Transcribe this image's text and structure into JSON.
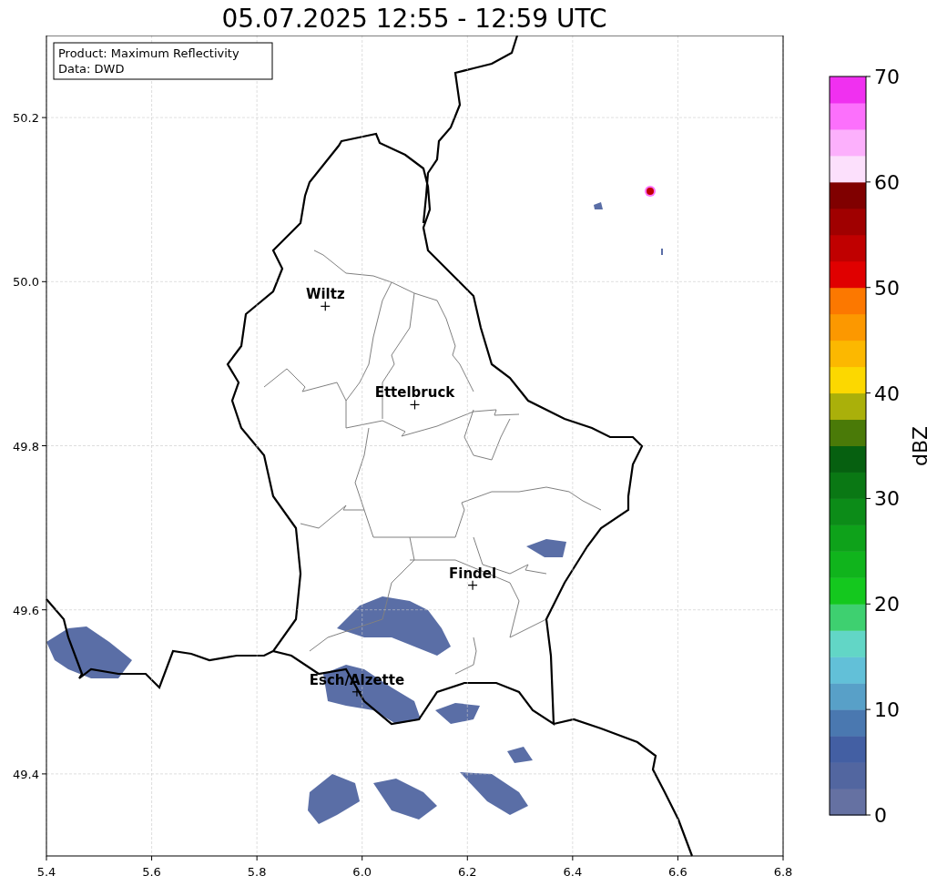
{
  "figure": {
    "info_box": {
      "lines": [
        "Product: Maximum Reflectivity",
        "Data: DWD"
      ]
    },
    "chart_data": {
      "type": "scatter",
      "title": "05.07.2025 12:55 - 12:59 UTC",
      "x": [
        5.93,
        6.1,
        6.21,
        5.99
      ],
      "series": [
        {
          "values": [
            49.97,
            49.85,
            49.63,
            49.5
          ]
        }
      ],
      "grid": true,
      "xlim": [
        5.4,
        6.8
      ],
      "ylim": [
        49.3,
        50.3
      ],
      "xticks": [
        {
          "value": 5.4,
          "label": "5.4"
        },
        {
          "value": 5.6,
          "label": "5.6"
        },
        {
          "value": 5.8,
          "label": "5.8"
        },
        {
          "value": 6.0,
          "label": "6.0"
        },
        {
          "value": 6.2,
          "label": "6.2"
        },
        {
          "value": 6.4,
          "label": "6.4"
        },
        {
          "value": 6.6,
          "label": "6.6"
        },
        {
          "value": 6.8,
          "label": "6.8"
        }
      ],
      "yticks": [
        {
          "value": 49.4,
          "label": "49.4"
        },
        {
          "value": 49.6,
          "label": "49.6"
        },
        {
          "value": 49.8,
          "label": "49.8"
        },
        {
          "value": 50.0,
          "label": "50.0"
        },
        {
          "value": 50.2,
          "label": "50.2"
        }
      ],
      "annotations": [
        {
          "text": "Wiltz",
          "x": 5.93,
          "y": 49.97
        },
        {
          "text": "Ettelbruck",
          "x": 6.1,
          "y": 49.85
        },
        {
          "text": "Findel",
          "x": 6.21,
          "y": 49.63
        },
        {
          "text": "Esch/Alzette",
          "x": 5.99,
          "y": 49.5
        }
      ]
    },
    "colorbar": {
      "label": "dBZ",
      "ticks": [
        "70",
        "60",
        "50",
        "40",
        "30",
        "20",
        "10",
        "0"
      ],
      "bins": [
        {
          "color": "#6571a2"
        },
        {
          "color": "#5266a0"
        },
        {
          "color": "#435fa3"
        },
        {
          "color": "#4a78b0"
        },
        {
          "color": "#58a0c8"
        },
        {
          "color": "#62c0d8"
        },
        {
          "color": "#62d6c6"
        },
        {
          "color": "#3ed070"
        },
        {
          "color": "#14c81e"
        },
        {
          "color": "#10b41c"
        },
        {
          "color": "#0ea21a"
        },
        {
          "color": "#0c8c18"
        },
        {
          "color": "#0a7814"
        },
        {
          "color": "#066010"
        },
        {
          "color": "#4a7a08"
        },
        {
          "color": "#aab00a"
        },
        {
          "color": "#fcd800"
        },
        {
          "color": "#fcb800"
        },
        {
          "color": "#fc9800"
        },
        {
          "color": "#fc7800"
        },
        {
          "color": "#e00000"
        },
        {
          "color": "#c00000"
        },
        {
          "color": "#a00000"
        },
        {
          "color": "#800000"
        },
        {
          "color": "#fce0fc"
        },
        {
          "color": "#fcb0fc"
        },
        {
          "color": "#fc70fc"
        },
        {
          "color": "#f030f0"
        }
      ]
    }
  }
}
